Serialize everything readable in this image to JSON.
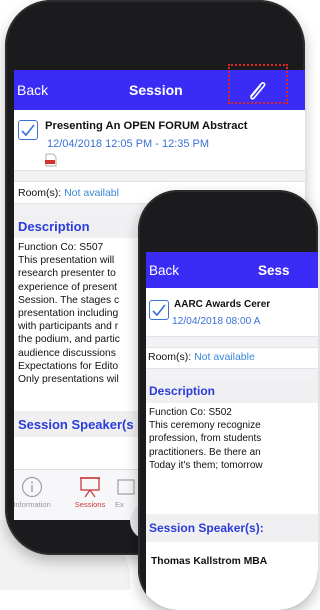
{
  "back_phone": {
    "nav": {
      "back_label": "Back",
      "title": "Session"
    },
    "session": {
      "title": "Presenting An OPEN FORUM Abstract",
      "time": "12/04/2018 12:05 PM - 12:35 PM"
    },
    "room": {
      "label": "Room(s):",
      "value": "Not availabl"
    },
    "description": {
      "header": "Description",
      "lines": [
        "Function Co: S507",
        "This presentation will",
        "research presenter to",
        "experience of present",
        "Session. The stages c",
        "presentation including",
        "with participants and r",
        "the podium, and partic",
        "audience discussions",
        "Expectations for Edito",
        "Only presentations wil"
      ]
    },
    "speakers_header": "Session Speaker(s",
    "tabs": [
      {
        "label": "Information",
        "icon": "info-icon"
      },
      {
        "label": "Sessions",
        "icon": "presentation-icon"
      },
      {
        "label": "Ex",
        "icon": "exhibit-icon"
      }
    ]
  },
  "front_phone": {
    "nav": {
      "back_label": "Back",
      "title": "Sess"
    },
    "session": {
      "title": "AARC Awards Cerer",
      "time": "12/04/2018 08:00 A"
    },
    "room": {
      "label": "Room(s):",
      "value": "Not available"
    },
    "description": {
      "header": "Description",
      "lines": [
        "Function Co: S502",
        "This ceremony recognize",
        "profession, from students",
        "practitioners. Be there an",
        "Today it's them; tomorrow"
      ]
    },
    "speakers_header": "Session Speaker(s):",
    "speaker_name": "Thomas Kallstrom MBA"
  },
  "colors": {
    "navbar": "#3a2cf5",
    "accent_blue": "#3a70d8",
    "section_header_text": "#2b3cd8",
    "highlight": "#d92626",
    "active_tab": "#c83a3a"
  }
}
